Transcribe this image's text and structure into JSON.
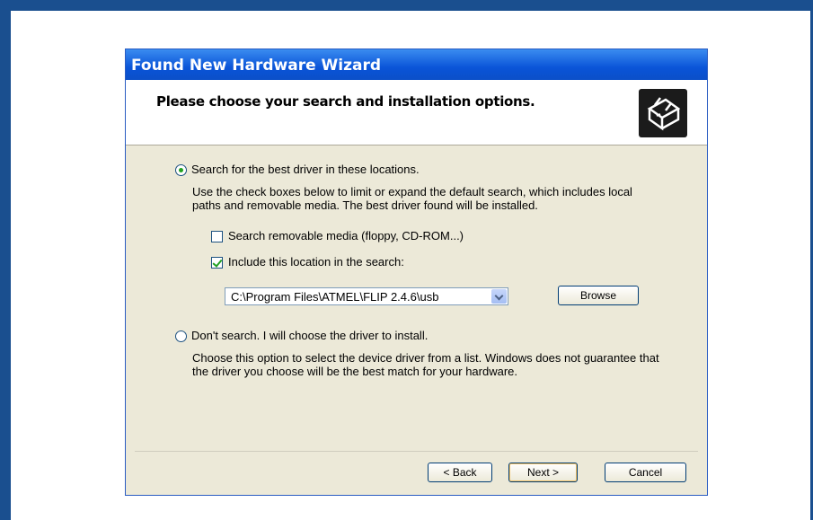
{
  "window": {
    "title": "Found New Hardware Wizard",
    "header_title": "Please choose your search and installation options."
  },
  "options": {
    "search": {
      "label": "Search for the best driver in these locations.",
      "description": [
        "Use the check boxes below to limit or expand the default search, which includes local",
        "paths and removable media. The best driver found will be installed."
      ],
      "selected": true
    },
    "removable_media": {
      "label": "Search removable media (floppy, CD-ROM...)",
      "checked": false
    },
    "include_location": {
      "label": "Include this location in the search:",
      "checked": true
    },
    "location_path": "C:\\Program Files\\ATMEL\\FLIP 2.4.6\\usb",
    "browse_label": "Browse",
    "dont_search": {
      "label": "Don't search. I will choose the driver to install.",
      "description": [
        "Choose this option to select the device driver from a list.  Windows does not guarantee that",
        "the driver you choose will be the best match for your hardware."
      ],
      "selected": false
    }
  },
  "buttons": {
    "back": "< Back",
    "next": "Next >",
    "cancel": "Cancel"
  },
  "icons": {
    "header": "hardware-wizard-icon",
    "dropdown": "chevron-down-icon"
  }
}
